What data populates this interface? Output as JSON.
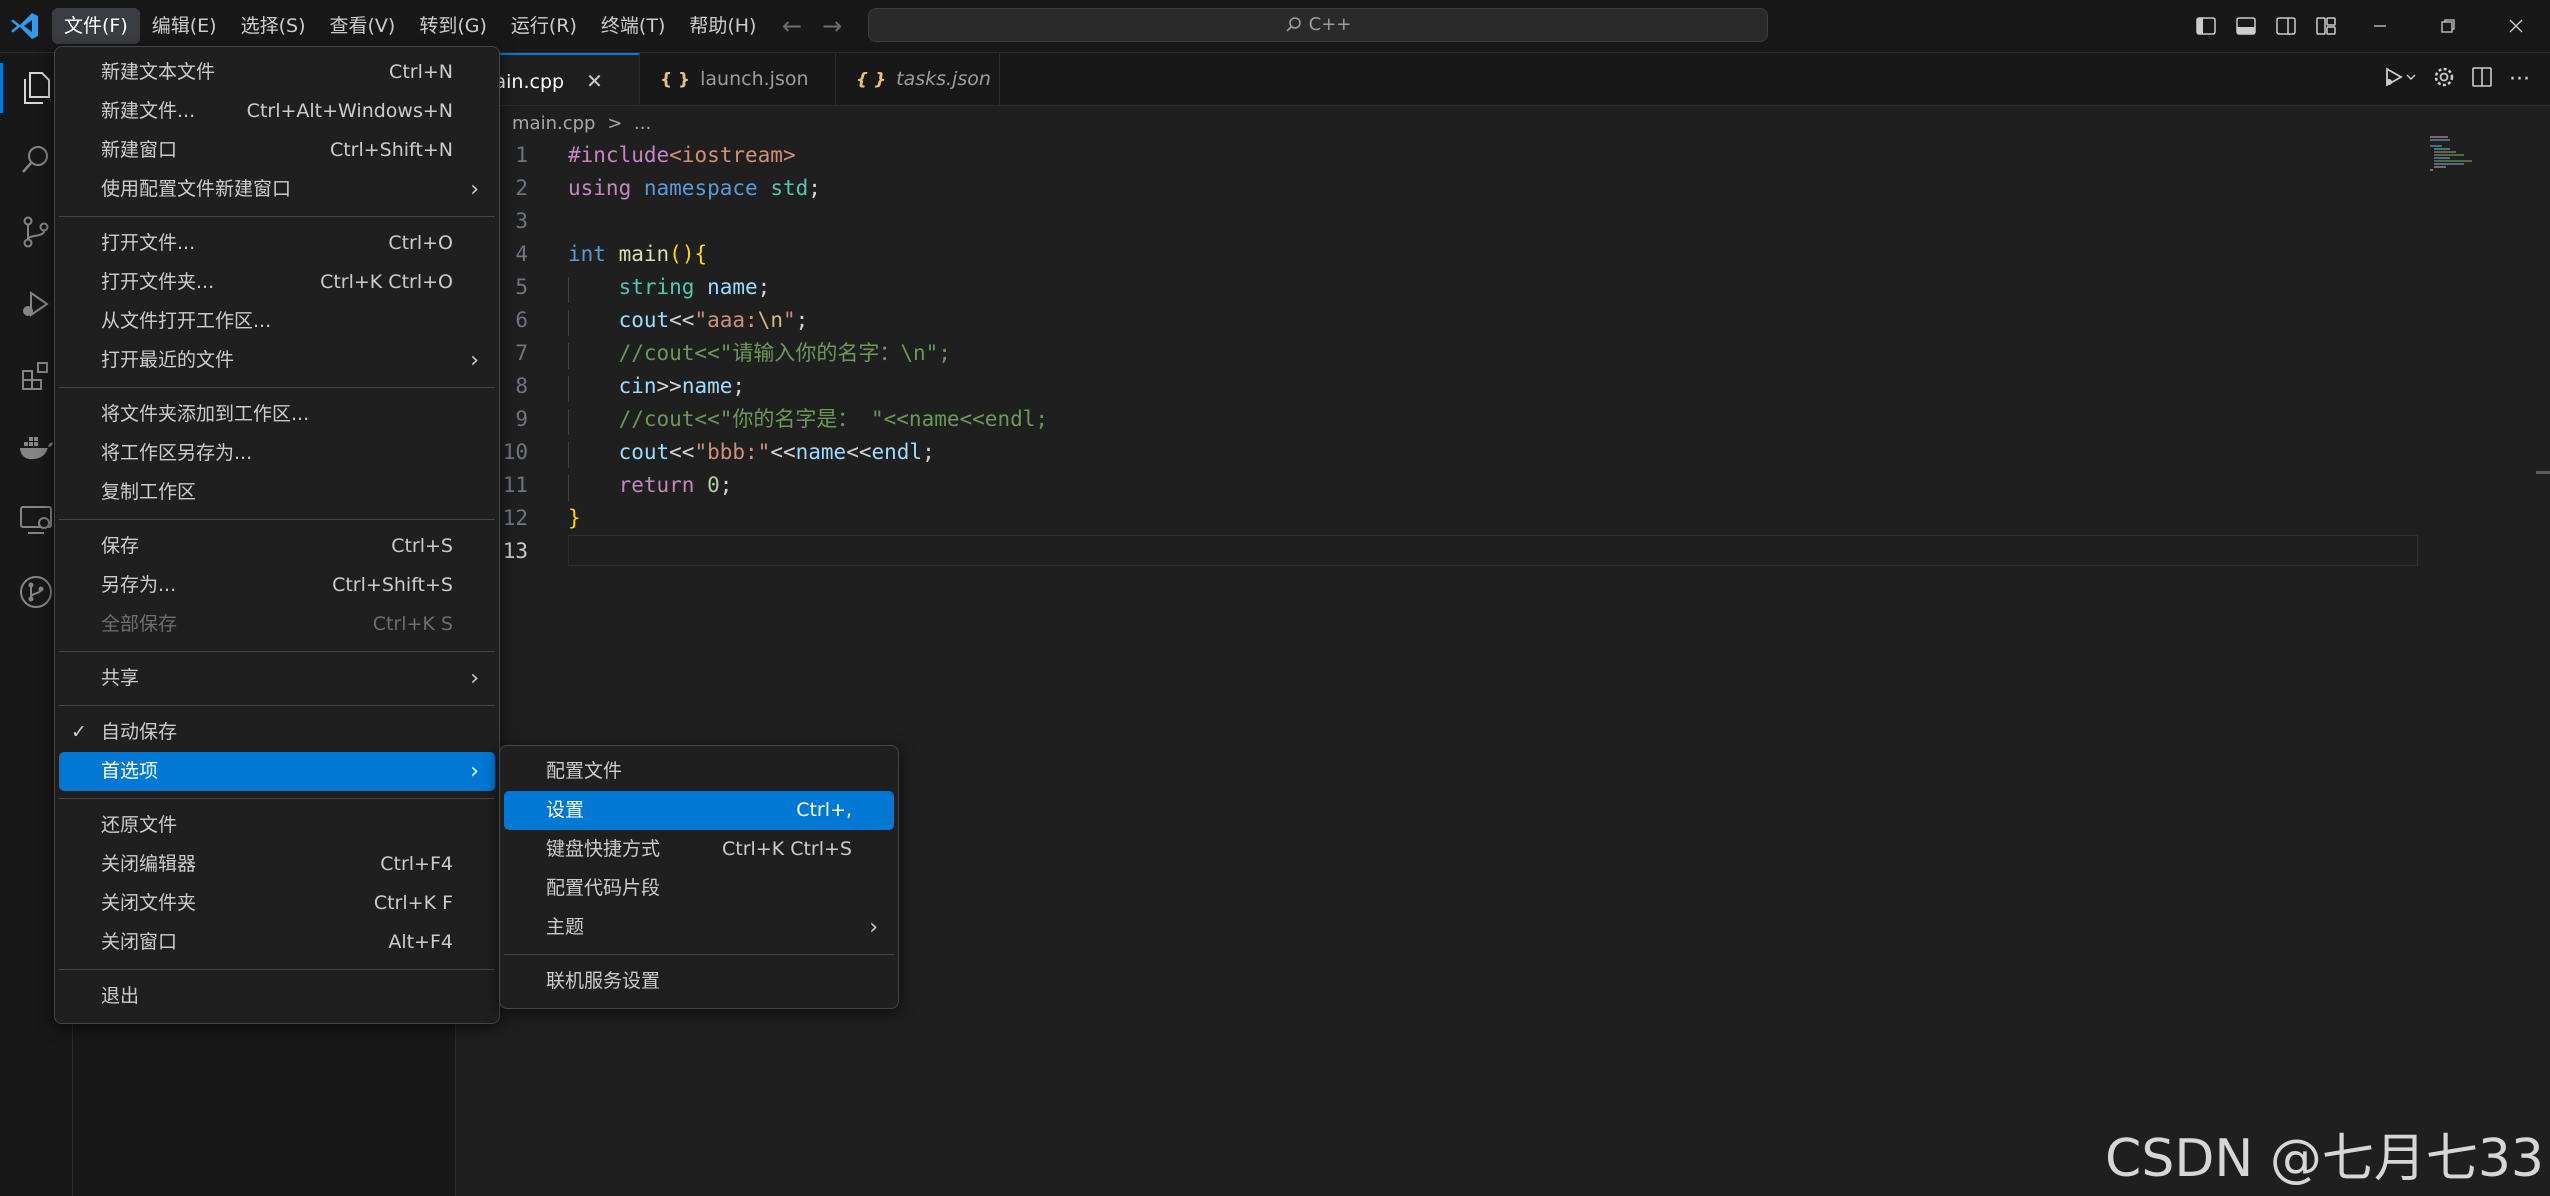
{
  "menubar": {
    "items": [
      "文件(F)",
      "编辑(E)",
      "选择(S)",
      "查看(V)",
      "转到(G)",
      "运行(R)",
      "终端(T)",
      "帮助(H)"
    ],
    "active_index": 0
  },
  "command_center": {
    "text": "C++"
  },
  "tabs": [
    {
      "label": "main.cpp",
      "active": true,
      "icon": "cpp-file-icon"
    },
    {
      "label": "launch.json",
      "active": false,
      "icon": "json-file-icon"
    },
    {
      "label": "tasks.json",
      "active": false,
      "icon": "json-file-icon"
    }
  ],
  "breadcrumb": {
    "file": "main.cpp",
    "sep": ">",
    "rest": "..."
  },
  "code": {
    "line_numbers": [
      "1",
      "2",
      "3",
      "4",
      "5",
      "6",
      "7",
      "8",
      "9",
      "10",
      "11",
      "12",
      "13"
    ],
    "current_line": 13
  },
  "file_menu": {
    "items": [
      {
        "label": "新建文本文件",
        "shortcut": "Ctrl+N"
      },
      {
        "label": "新建文件...",
        "shortcut": "Ctrl+Alt+Windows+N"
      },
      {
        "label": "新建窗口",
        "shortcut": "Ctrl+Shift+N"
      },
      {
        "label": "使用配置文件新建窗口",
        "submenu": true
      },
      {
        "sep": true
      },
      {
        "label": "打开文件...",
        "shortcut": "Ctrl+O"
      },
      {
        "label": "打开文件夹...",
        "shortcut": "Ctrl+K Ctrl+O"
      },
      {
        "label": "从文件打开工作区..."
      },
      {
        "label": "打开最近的文件",
        "submenu": true
      },
      {
        "sep": true
      },
      {
        "label": "将文件夹添加到工作区..."
      },
      {
        "label": "将工作区另存为..."
      },
      {
        "label": "复制工作区"
      },
      {
        "sep": true
      },
      {
        "label": "保存",
        "shortcut": "Ctrl+S"
      },
      {
        "label": "另存为...",
        "shortcut": "Ctrl+Shift+S"
      },
      {
        "label": "全部保存",
        "shortcut": "Ctrl+K S",
        "disabled": true
      },
      {
        "sep": true
      },
      {
        "label": "共享",
        "submenu": true
      },
      {
        "sep": true
      },
      {
        "label": "自动保存",
        "checked": true
      },
      {
        "label": "首选项",
        "submenu": true,
        "highlighted": true
      },
      {
        "sep": true
      },
      {
        "label": "还原文件"
      },
      {
        "label": "关闭编辑器",
        "shortcut": "Ctrl+F4"
      },
      {
        "label": "关闭文件夹",
        "shortcut": "Ctrl+K F"
      },
      {
        "label": "关闭窗口",
        "shortcut": "Alt+F4"
      },
      {
        "sep": true
      },
      {
        "label": "退出"
      }
    ]
  },
  "preferences_menu": {
    "items": [
      {
        "label": "配置文件"
      },
      {
        "label": "设置",
        "shortcut": "Ctrl+,",
        "highlighted": true
      },
      {
        "label": "键盘快捷方式",
        "shortcut": "Ctrl+K Ctrl+S"
      },
      {
        "label": "配置代码片段"
      },
      {
        "label": "主题",
        "submenu": true
      },
      {
        "sep": true
      },
      {
        "label": "联机服务设置"
      }
    ]
  },
  "watermark": "CSDN @七月七33",
  "colors": {
    "accent": "#0078d4",
    "menu_bg": "#1f1f1f",
    "editor_bg": "#1f1f1f"
  }
}
